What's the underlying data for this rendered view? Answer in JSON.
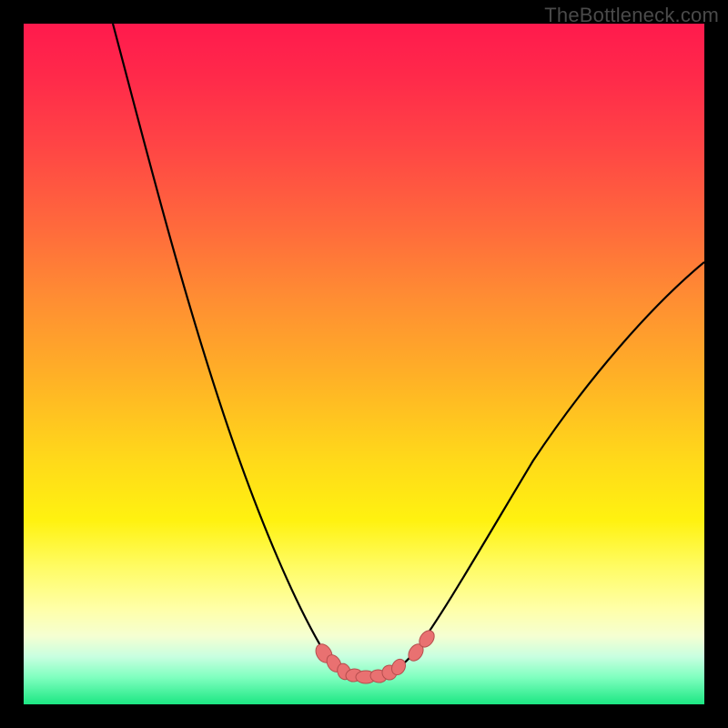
{
  "watermark": "TheBottleneck.com",
  "colors": {
    "curve_stroke": "#000000",
    "marker_fill": "#e97171",
    "marker_stroke": "#9a3c3c"
  },
  "chart_data": {
    "type": "line",
    "title": "",
    "xlabel": "",
    "ylabel": "",
    "xlim": [
      0,
      100
    ],
    "ylim": [
      0,
      100
    ],
    "grid": false,
    "legend": false,
    "note": "No axis ticks or labels visible. Values below are estimates read from pixel positions; y is downward in image pixel coordinates (0 at top, 100 at bottom).",
    "series": [
      {
        "name": "left-curve",
        "x": [
          13,
          16,
          20,
          24,
          28,
          32,
          36,
          40,
          43,
          45,
          47,
          49,
          50
        ],
        "y": [
          0,
          12,
          27,
          41,
          54,
          65,
          75,
          84,
          90,
          93,
          95,
          96,
          96
        ]
      },
      {
        "name": "right-curve",
        "x": [
          50,
          53,
          56,
          58,
          60,
          64,
          70,
          78,
          86,
          94,
          100
        ],
        "y": [
          96,
          96,
          95,
          93,
          90,
          83,
          72,
          59,
          48,
          40,
          35
        ]
      },
      {
        "name": "bottom-markers",
        "x": [
          44.0,
          45.5,
          47.0,
          48.5,
          50.0,
          51.5,
          53.0,
          54.5,
          57.5,
          59.0
        ],
        "y": [
          92.5,
          94.0,
          95.2,
          95.8,
          96.0,
          96.0,
          95.8,
          95.2,
          92.8,
          90.5
        ]
      }
    ]
  }
}
